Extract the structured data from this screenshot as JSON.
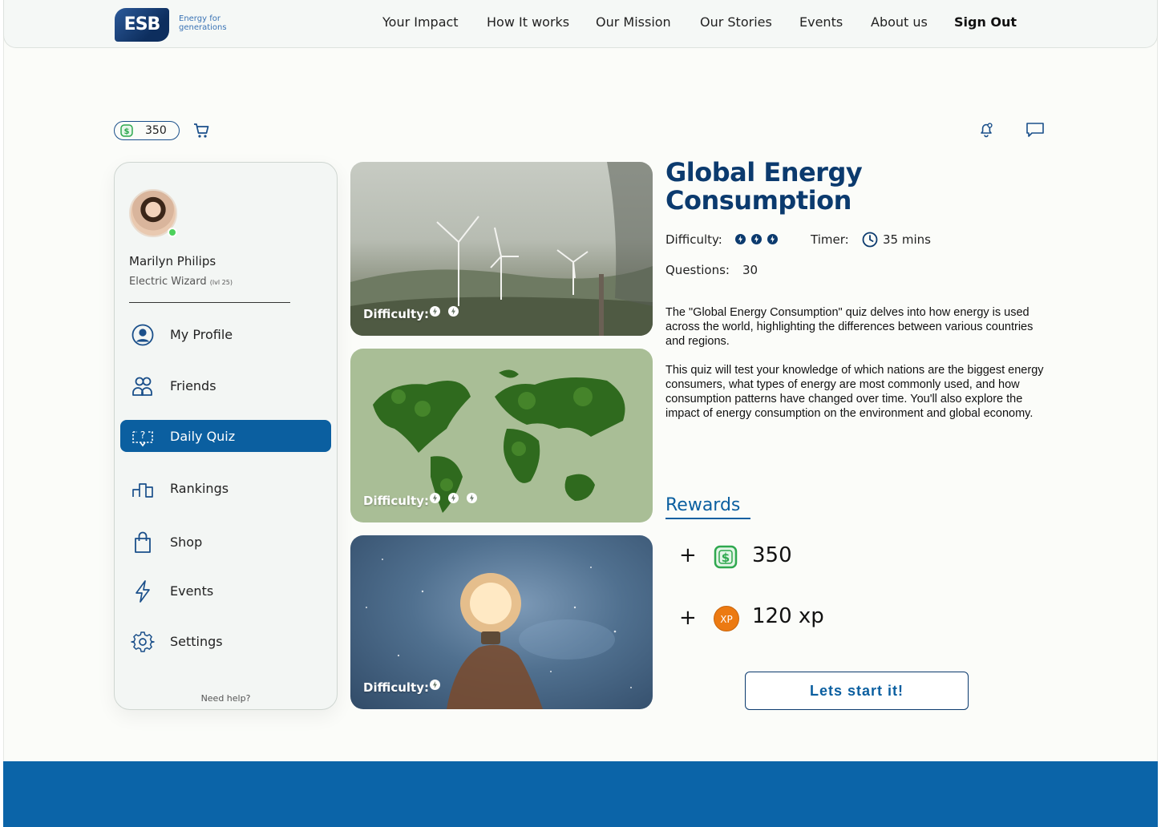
{
  "brand": {
    "logo_text": "ESB",
    "tagline": "Energy for generations"
  },
  "nav": {
    "items": [
      "Your Impact",
      "How It works",
      "Our Mission",
      "Our Stories",
      "Events",
      "About us"
    ],
    "sign_out": "Sign Out"
  },
  "wallet": {
    "coins": "350"
  },
  "user": {
    "name": "Marilyn Philips",
    "role": "Electric Wizard",
    "level": "(lvl 25)"
  },
  "sidebar": {
    "items": [
      {
        "label": "My Profile",
        "icon": "user-circle-icon"
      },
      {
        "label": "Friends",
        "icon": "friends-icon"
      },
      {
        "label": "Daily Quiz",
        "icon": "quiz-icon",
        "active": true
      },
      {
        "label": "Rankings",
        "icon": "podium-icon"
      },
      {
        "label": "Shop",
        "icon": "shopping-bag-icon"
      },
      {
        "label": "Events",
        "icon": "lightning-icon"
      },
      {
        "label": "Settings",
        "icon": "gear-icon"
      }
    ],
    "help": "Need help?"
  },
  "quiz_cards": [
    {
      "difficulty_label": "Difficulty:",
      "difficulty": 2,
      "image": "wind-turbines"
    },
    {
      "difficulty_label": "Difficulty:",
      "difficulty": 3,
      "image": "moss-world-map"
    },
    {
      "difficulty_label": "Difficulty:",
      "difficulty": 1,
      "image": "lightbulb-in-space"
    }
  ],
  "quiz": {
    "title": "Global Energy Consumption",
    "difficulty_label": "Difficulty:",
    "difficulty": 3,
    "timer_label": "Timer:",
    "timer_value": "35 mins",
    "questions_label": "Questions:",
    "questions_value": "30",
    "description_1": "The \"Global Energy Consumption\" quiz delves into how energy is used across the world, highlighting the differences between various countries and regions.",
    "description_2": "This quiz will test your knowledge of which nations are the biggest energy consumers, what types of energy are most commonly used, and how consumption patterns have changed over time. You'll also explore the impact of energy consumption on the environment and global economy.",
    "rewards_heading": "Rewards",
    "rewards": [
      {
        "plus": "+",
        "icon": "coin-icon",
        "value": "350"
      },
      {
        "plus": "+",
        "icon": "xp-badge",
        "badge": "XP",
        "value": "120 xp"
      }
    ],
    "start_label": "Lets start it!"
  },
  "colors": {
    "primary": "#0b5fa0",
    "navy": "#0b3a6e",
    "coin_green": "#2fa84f",
    "xp_orange": "#ec7a12"
  }
}
